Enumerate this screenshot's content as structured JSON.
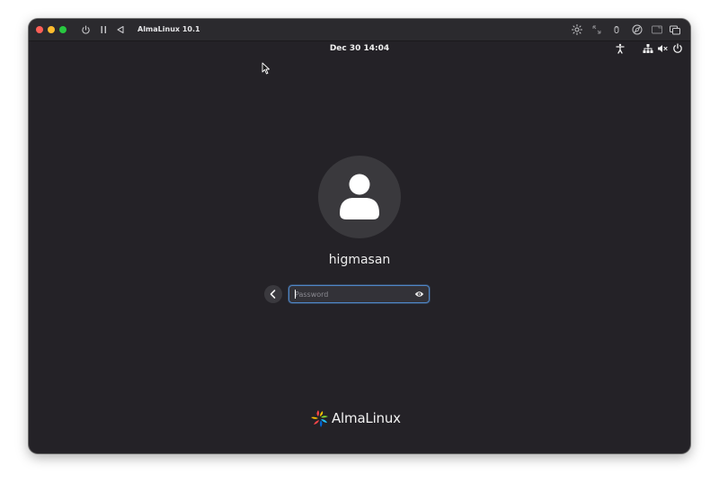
{
  "window": {
    "title": "AlmaLinux 10.1",
    "traffic_colors": [
      "#fe5f57",
      "#febc2e",
      "#28c840"
    ]
  },
  "topbar": {
    "clock": "Dec 30  14:04"
  },
  "login": {
    "username": "higmasan",
    "password_placeholder": "Password",
    "focus_color": "#4f86c6"
  },
  "branding": {
    "name": "AlmaLinux"
  },
  "icons": {
    "titlebar": [
      "power-icon",
      "pause-icon",
      "back-triangle-icon"
    ],
    "titlebar_right": [
      "brightness-icon",
      "resize-icon",
      "mouse-icon",
      "compass-icon",
      "display-icon",
      "windows-icon"
    ],
    "topbar_right": [
      "accessibility-icon",
      "network-icon",
      "volume-muted-icon",
      "power-icon"
    ]
  }
}
